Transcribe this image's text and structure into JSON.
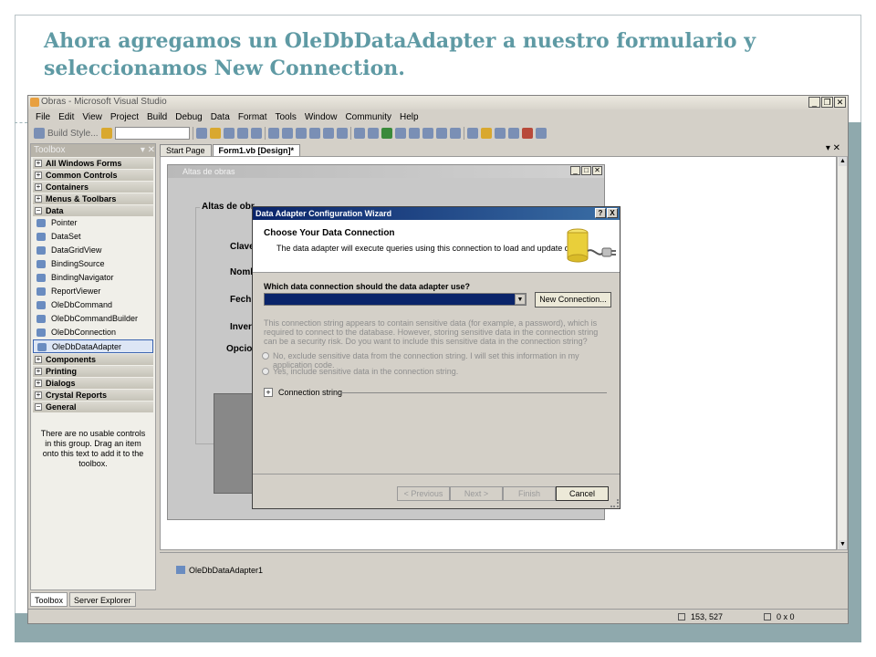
{
  "slide": {
    "title": "Ahora agregamos un OleDbDataAdapter a nuestro formulario y seleccionamos  New Connection."
  },
  "vs": {
    "window_title": "Obras - Microsoft Visual Studio",
    "menu": [
      "File",
      "Edit",
      "View",
      "Project",
      "Build",
      "Debug",
      "Data",
      "Format",
      "Tools",
      "Window",
      "Community",
      "Help"
    ],
    "build_style_label": "Build Style...",
    "toolbox": {
      "title": "Toolbox",
      "categories_top": [
        "All Windows Forms",
        "Common Controls",
        "Containers",
        "Menus & Toolbars",
        "Data"
      ],
      "data_items": [
        "Pointer",
        "DataSet",
        "DataGridView",
        "BindingSource",
        "BindingNavigator",
        "ReportViewer",
        "OleDbCommand",
        "OleDbCommandBuilder",
        "OleDbConnection",
        "OleDbDataAdapter"
      ],
      "selected_item": "OleDbDataAdapter",
      "categories_bottom": [
        "Components",
        "Printing",
        "Dialogs",
        "Crystal Reports",
        "General"
      ],
      "empty_note": "There are no usable controls in this group. Drag an item onto this text to add it to the toolbox.",
      "bottom_tabs": [
        "Toolbox",
        "Server Explorer"
      ]
    },
    "doc_tabs": [
      "Start Page",
      "Form1.vb [Design]*"
    ],
    "form": {
      "title": "Altas de obras",
      "group_caption": "Altas de obr",
      "labels": [
        "Clave",
        "Nomb",
        "Fech",
        "Inver"
      ],
      "sub_group_caption": "Opcio"
    },
    "tray_item": "OleDbDataAdapter1",
    "status": {
      "position": "153, 527",
      "size": "0 x 0"
    }
  },
  "wizard": {
    "title": "Data Adapter Configuration Wizard",
    "title_buttons": [
      "?",
      "X"
    ],
    "header_title": "Choose Your Data Connection",
    "header_subtitle": "The data adapter will execute queries using this connection to load and update data.",
    "question": "Which data connection should the data adapter use?",
    "new_connection_label": "New Connection...",
    "sensitive_text": "This connection string appears to contain sensitive data (for example, a password), which is required to connect to the database. However, storing sensitive data in the connection string can be a security risk. Do you want to include this sensitive data in the connection string?",
    "radio_no": "No, exclude sensitive data from the connection string. I will set this information in my application code.",
    "radio_yes": "Yes, include sensitive data in the connection string.",
    "connection_string_label": "Connection string",
    "buttons": {
      "previous": "< Previous",
      "next": "Next >",
      "finish": "Finish",
      "cancel": "Cancel"
    }
  }
}
